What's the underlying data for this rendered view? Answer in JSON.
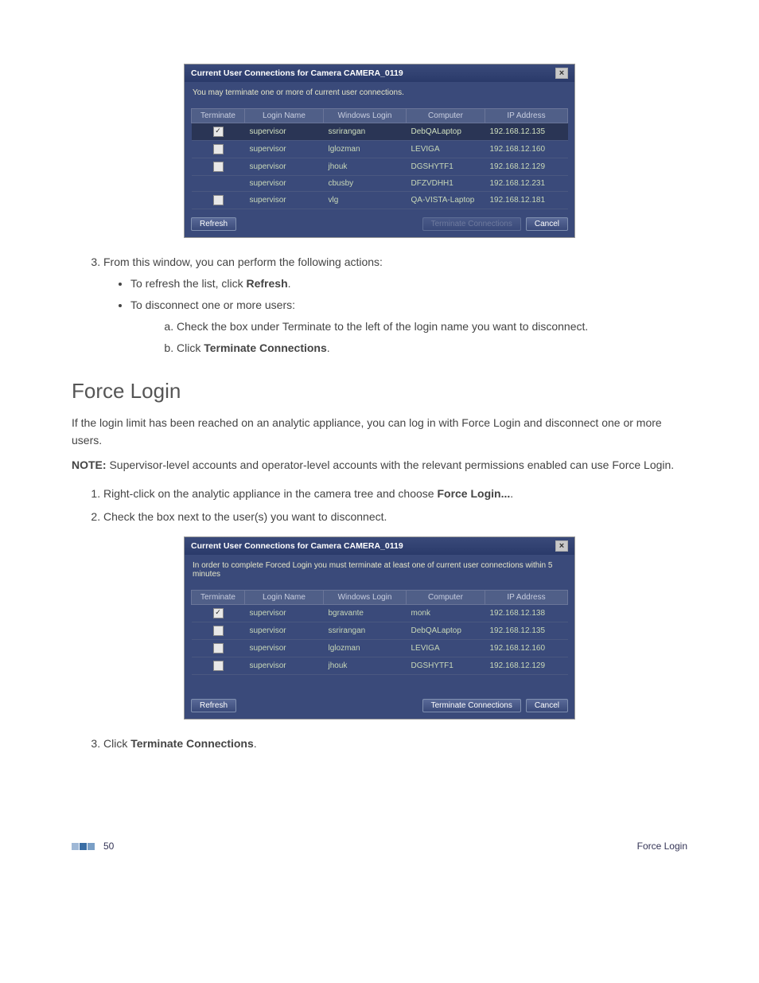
{
  "dialog1": {
    "title": "Current User Connections for Camera CAMERA_0119",
    "message": "You may terminate one or more of current user connections.",
    "headers": {
      "terminate": "Terminate",
      "login": "Login Name",
      "winlogin": "Windows Login",
      "computer": "Computer",
      "ip": "IP Address"
    },
    "rows": [
      {
        "checked": true,
        "sel": true,
        "login": "supervisor",
        "winlogin": "ssrirangan",
        "computer": "DebQALaptop",
        "ip": "192.168.12.135"
      },
      {
        "checked": false,
        "sel": false,
        "login": "supervisor",
        "winlogin": "lglozman",
        "computer": "LEVIGA",
        "ip": "192.168.12.160"
      },
      {
        "checked": false,
        "sel": false,
        "login": "supervisor",
        "winlogin": "jhouk",
        "computer": "DGSHYTF1",
        "ip": "192.168.12.129"
      },
      {
        "checked": null,
        "sel": false,
        "login": "supervisor",
        "winlogin": "cbusby",
        "computer": "DFZVDHH1",
        "ip": "192.168.12.231"
      },
      {
        "checked": false,
        "sel": false,
        "login": "supervisor",
        "winlogin": "vlg",
        "computer": "QA-VISTA-Laptop",
        "ip": "192.168.12.181"
      }
    ],
    "buttons": {
      "refresh": "Refresh",
      "terminate": "Terminate Connections",
      "cancel": "Cancel"
    },
    "terminate_enabled": false
  },
  "dialog2": {
    "title": "Current User Connections for Camera CAMERA_0119",
    "message": "In order to complete Forced Login you must terminate at least one of current user connections within 5 minutes",
    "headers": {
      "terminate": "Terminate",
      "login": "Login Name",
      "winlogin": "Windows Login",
      "computer": "Computer",
      "ip": "IP Address"
    },
    "rows": [
      {
        "checked": true,
        "sel": false,
        "login": "supervisor",
        "winlogin": "bgravante",
        "computer": "monk",
        "ip": "192.168.12.138"
      },
      {
        "checked": false,
        "sel": false,
        "login": "supervisor",
        "winlogin": "ssrirangan",
        "computer": "DebQALaptop",
        "ip": "192.168.12.135"
      },
      {
        "checked": false,
        "sel": false,
        "login": "supervisor",
        "winlogin": "lglozman",
        "computer": "LEVIGA",
        "ip": "192.168.12.160"
      },
      {
        "checked": false,
        "sel": false,
        "login": "supervisor",
        "winlogin": "jhouk",
        "computer": "DGSHYTF1",
        "ip": "192.168.12.129"
      }
    ],
    "buttons": {
      "refresh": "Refresh",
      "terminate": "Terminate Connections",
      "cancel": "Cancel"
    },
    "terminate_enabled": true
  },
  "text": {
    "step3_intro": "From this window, you can perform the following actions:",
    "bullet_refresh_pre": "To refresh the list, click ",
    "bullet_refresh_bold": "Refresh",
    "bullet_refresh_post": ".",
    "bullet_disconnect": "To disconnect one or more users:",
    "sub_a": "Check the box under Terminate to the left of the login name you want to disconnect.",
    "sub_b_pre": "Click ",
    "sub_b_bold": "Terminate Connections",
    "sub_b_post": ".",
    "h2": "Force Login",
    "p1": "If the login limit has been reached on an analytic appliance, you can log in with Force Login and disconnect one or more users.",
    "note_label": "NOTE:",
    "note_body": " Supervisor-level accounts and operator-level accounts with the relevant permissions enabled can use Force Login.",
    "ol2_1_pre": "Right-click on the analytic appliance in the camera tree and choose ",
    "ol2_1_bold": "Force Login...",
    "ol2_1_post": ".",
    "ol2_2": "Check the box next to the user(s) you want to disconnect.",
    "ol2_3_pre": "Click ",
    "ol2_3_bold": "Terminate Connections",
    "ol2_3_post": "."
  },
  "footer": {
    "page": "50",
    "section": "Force Login"
  }
}
